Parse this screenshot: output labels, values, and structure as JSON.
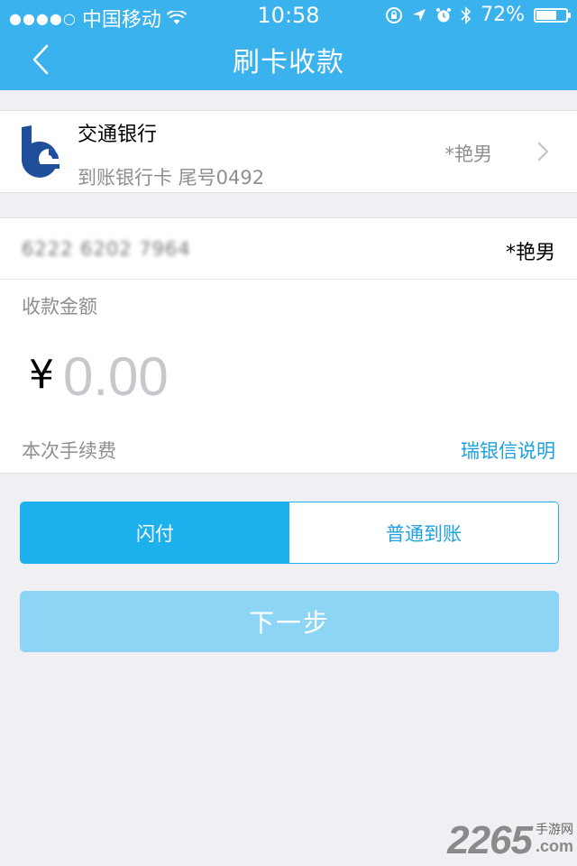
{
  "status_bar": {
    "signal": "●●●●○",
    "carrier": "中国移动",
    "time": "10:58",
    "battery_percent": "72%",
    "battery_level": 0.72
  },
  "nav": {
    "title": "刷卡收款"
  },
  "bank": {
    "name": "交通银行",
    "description": "到账银行卡  尾号0492",
    "holder": "*艳男"
  },
  "card": {
    "number": "6222 6202 7964",
    "holder": "*艳男"
  },
  "amount": {
    "label": "收款金额",
    "currency": "¥",
    "placeholder": "0.00"
  },
  "fee": {
    "label": "本次手续费",
    "link": "瑞银信说明"
  },
  "segment": {
    "option1": "闪付",
    "option2": "普通到账"
  },
  "next_button": "下一步",
  "watermark": {
    "number": "2265",
    "site": "手游网",
    "domain": ".com"
  },
  "colors": {
    "primary": "#39b2ed",
    "accent": "#1cb0ec",
    "button_disabled": "#8dd5f5",
    "link": "#1da1e0",
    "background": "#efeff4"
  }
}
